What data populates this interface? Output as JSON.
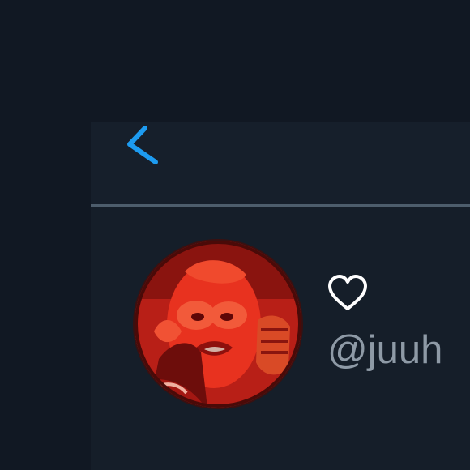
{
  "profile": {
    "handle": "@juuh"
  },
  "icons": {
    "back": "chevron-left-icon",
    "heart": "heart-outline-icon"
  },
  "colors": {
    "background": "#141c28",
    "accent": "#1d9bf0",
    "divider": "#4d5d6c",
    "handle_text": "#8e9aa6",
    "avatar_tint": "#d62a1f"
  }
}
